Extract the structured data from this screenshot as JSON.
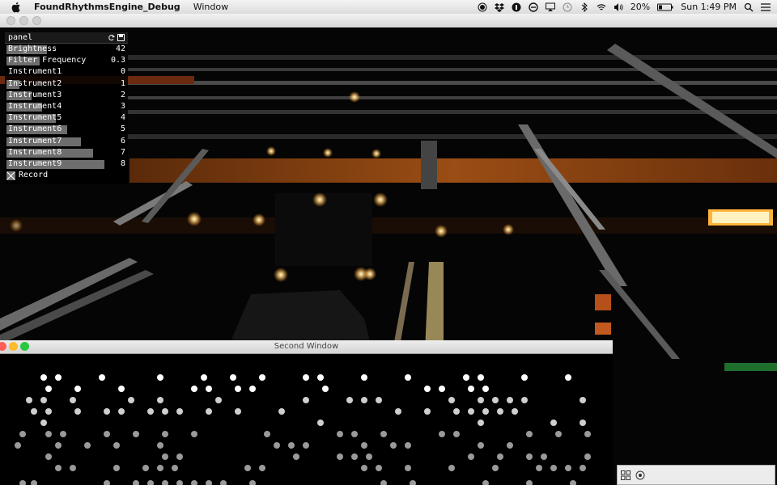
{
  "menubar": {
    "app_name": "FoundRhythmsEngine_Debug",
    "menus": [
      "Window"
    ],
    "battery": "20%",
    "clock": "Sun 1:49 PM"
  },
  "panel": {
    "title": "panel",
    "sliders": [
      {
        "label": "Brightness",
        "value": "42",
        "fill": 0.34
      },
      {
        "label": "Filter Frequency",
        "value": "0.3",
        "fill": 0.28
      },
      {
        "label": "Instrument1",
        "value": "0",
        "fill": 0.0
      },
      {
        "label": "Instrument2",
        "value": "1",
        "fill": 0.11
      },
      {
        "label": "Instrument3",
        "value": "2",
        "fill": 0.21
      },
      {
        "label": "Instrument4",
        "value": "3",
        "fill": 0.3
      },
      {
        "label": "Instrument5",
        "value": "4",
        "fill": 0.41
      },
      {
        "label": "Instrument6",
        "value": "5",
        "fill": 0.51
      },
      {
        "label": "Instrument7",
        "value": "6",
        "fill": 0.62
      },
      {
        "label": "Instrument8",
        "value": "7",
        "fill": 0.72
      },
      {
        "label": "Instrument9",
        "value": "8",
        "fill": 0.82
      }
    ],
    "toggle_label": "Record",
    "toggle_checked": true
  },
  "second_window": {
    "title": "Second Window"
  },
  "colors": {
    "traffic_red": "#fc5f57",
    "traffic_yellow": "#fdbc2e",
    "traffic_green": "#28c840",
    "bridge_orange": "#b65a14",
    "dot_white": "#ffffff",
    "dot_grey": "#9a9a9a"
  }
}
